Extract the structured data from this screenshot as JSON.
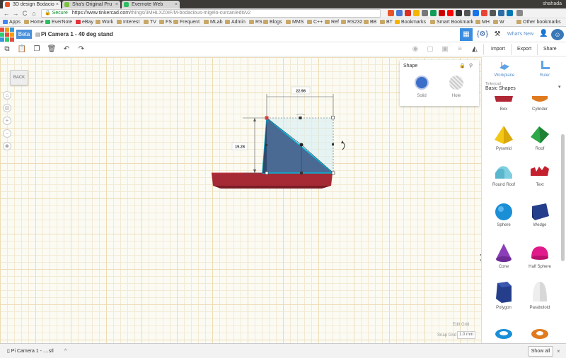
{
  "os": {
    "user": "shahada"
  },
  "browser": {
    "tabs": [
      {
        "label": "3D design Bodacio",
        "active": true,
        "favicon_color": "#e8542a"
      },
      {
        "label": "Sha's Original Pru",
        "active": false,
        "favicon_color": "#7cc242"
      },
      {
        "label": "Evernote Web",
        "active": false,
        "favicon_color": "#2dbe60"
      }
    ],
    "tab_close": "×",
    "nav": {
      "back": "←",
      "forward": "→",
      "reload": "C",
      "home": "⌂"
    },
    "address": {
      "lock": "🔒",
      "secure_label": "Secure",
      "domain": "https://www.tinkercad.com",
      "path": "/things/3MHLXZ0IF/M-bodacious-migelo-curcan/edit/v2"
    },
    "bookmarks": [
      {
        "label": "Apps"
      },
      {
        "label": "Home"
      },
      {
        "label": "EverNote"
      },
      {
        "label": "eBay"
      },
      {
        "label": "Work"
      },
      {
        "label": "Interest"
      },
      {
        "label": "TV"
      },
      {
        "label": "FS"
      },
      {
        "label": "Frequent"
      },
      {
        "label": "MLab"
      },
      {
        "label": "Admin"
      },
      {
        "label": "RS"
      },
      {
        "label": "Blogs"
      },
      {
        "label": "MMS"
      },
      {
        "label": "C++"
      },
      {
        "label": "Ref"
      },
      {
        "label": "RS232"
      },
      {
        "label": "BB"
      },
      {
        "label": "BT"
      },
      {
        "label": "Bookmarks"
      },
      {
        "label": "Smart Bookmark"
      },
      {
        "label": "MH"
      },
      {
        "label": "W"
      },
      {
        "label": "Other bookmarks"
      }
    ]
  },
  "app": {
    "logo_letters": [
      "TIN",
      "KER",
      "CAD"
    ],
    "beta": "Beta",
    "doc_title": "Pi Camera 1 - 40 deg stand",
    "whats_new": "What's New",
    "import": "Import",
    "export": "Export",
    "share": "Share"
  },
  "canvas": {
    "back": "BACK",
    "dim_width": "22.98",
    "dim_height": "19.28",
    "edit_grid": "Edit Grid",
    "snap_grid_label": "Snap Grid",
    "snap_grid_value": "1.0 mm",
    "colors": {
      "wedge": "#3d5e8c",
      "base": "#a62a35",
      "accent_blue": "#3a8de0"
    }
  },
  "shape_panel": {
    "title": "Shape",
    "solid": "Solid",
    "hole": "Hole"
  },
  "right_panel": {
    "workplane": "Workplane",
    "ruler": "Ruler",
    "category_small": "Tinkercad",
    "category": "Basic Shapes",
    "shapes": [
      {
        "label": "Box"
      },
      {
        "label": "Cylinder"
      },
      {
        "label": "Pyramid"
      },
      {
        "label": "Roof"
      },
      {
        "label": "Round Roof"
      },
      {
        "label": "Text"
      },
      {
        "label": "Sphere"
      },
      {
        "label": "Wedge"
      },
      {
        "label": "Cone"
      },
      {
        "label": "Half Sphere"
      },
      {
        "label": "Polygon"
      },
      {
        "label": "Paraboloid"
      }
    ]
  },
  "downloads": {
    "file": "Pi Camera 1 - ....stl",
    "show_all": "Show all",
    "arrow": "^",
    "close": "×"
  }
}
